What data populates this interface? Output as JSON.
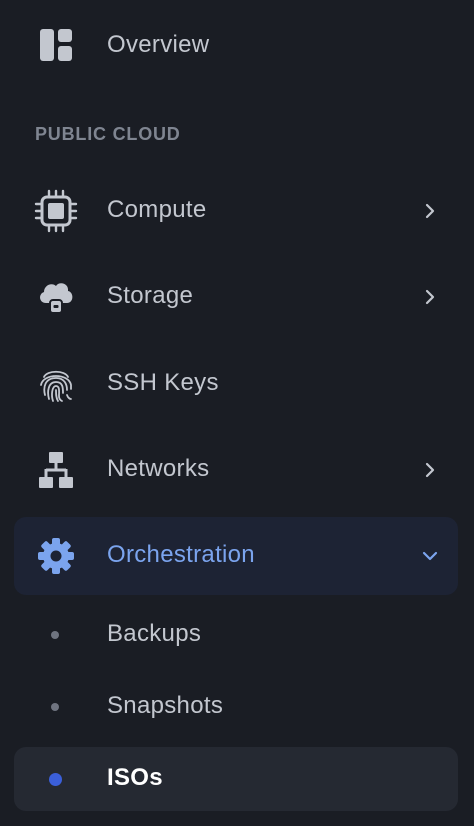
{
  "nav": {
    "overview": {
      "label": "Overview",
      "icon": "dashboard-icon"
    },
    "section_title": "PUBLIC CLOUD",
    "items": [
      {
        "label": "Compute",
        "icon": "cpu-chip-icon",
        "has_submenu": true,
        "expanded": false
      },
      {
        "label": "Storage",
        "icon": "cloud-lock-icon",
        "has_submenu": true,
        "expanded": false
      },
      {
        "label": "SSH Keys",
        "icon": "fingerprint-icon",
        "has_submenu": false
      },
      {
        "label": "Networks",
        "icon": "network-icon",
        "has_submenu": true,
        "expanded": false
      },
      {
        "label": "Orchestration",
        "icon": "gear-icon",
        "has_submenu": true,
        "expanded": true
      }
    ],
    "subitems": [
      {
        "label": "Backups",
        "selected": false
      },
      {
        "label": "Snapshots",
        "selected": false
      },
      {
        "label": "ISOs",
        "selected": true
      }
    ]
  },
  "colors": {
    "background": "#1a1d24",
    "text": "#c3c7cf",
    "section_title": "#7f8591",
    "active_text": "#7ba4ee",
    "active_bg": "#1d2334",
    "selected_bg": "#252932",
    "selected_dot": "#3b5fd9"
  }
}
